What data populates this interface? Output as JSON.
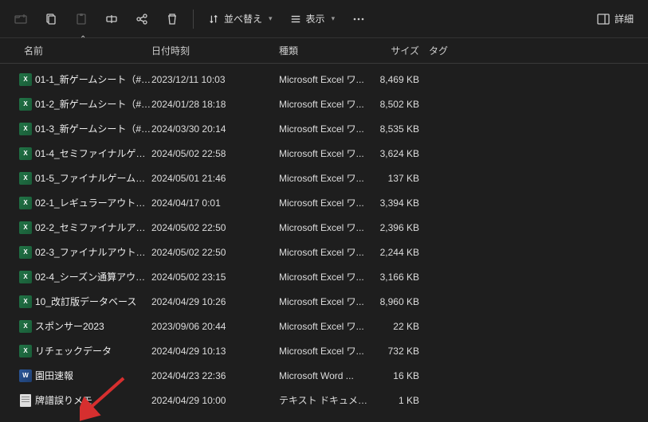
{
  "toolbar": {
    "sort_label": "並べ替え",
    "view_label": "表示",
    "details_label": "詳細"
  },
  "columns": {
    "name": "名前",
    "date": "日付時刻",
    "kind": "種類",
    "size": "サイズ",
    "tag": "タグ"
  },
  "files": [
    {
      "name": "01-1_新ゲームシート（#0...",
      "date": "2023/12/11 10:03",
      "kind": "Microsoft Excel ワ...",
      "size": "8,469 KB",
      "icon": "xlsx"
    },
    {
      "name": "01-2_新ゲームシート（#0...",
      "date": "2024/01/28 18:18",
      "kind": "Microsoft Excel ワ...",
      "size": "8,502 KB",
      "icon": "xlsx"
    },
    {
      "name": "01-3_新ゲームシート（#1...",
      "date": "2024/03/30 20:14",
      "kind": "Microsoft Excel ワ...",
      "size": "8,535 KB",
      "icon": "xlsx"
    },
    {
      "name": "01-4_セミファイナルゲーム...",
      "date": "2024/05/02 22:58",
      "kind": "Microsoft Excel ワ...",
      "size": "3,624 KB",
      "icon": "xlsx"
    },
    {
      "name": "01-5_ファイナルゲームシート",
      "date": "2024/05/01 21:46",
      "kind": "Microsoft Excel ワ...",
      "size": "137 KB",
      "icon": "xlsx"
    },
    {
      "name": "02-1_レギュラーアウトプッ...",
      "date": "2024/04/17 0:01",
      "kind": "Microsoft Excel ワ...",
      "size": "3,394 KB",
      "icon": "xlsx"
    },
    {
      "name": "02-2_セミファイナルアウト...",
      "date": "2024/05/02 22:50",
      "kind": "Microsoft Excel ワ...",
      "size": "2,396 KB",
      "icon": "xlsx"
    },
    {
      "name": "02-3_ファイナルアウトプッ...",
      "date": "2024/05/02 22:50",
      "kind": "Microsoft Excel ワ...",
      "size": "2,244 KB",
      "icon": "xlsx"
    },
    {
      "name": "02-4_シーズン通算アウト...",
      "date": "2024/05/02 23:15",
      "kind": "Microsoft Excel ワ...",
      "size": "3,166 KB",
      "icon": "xlsx"
    },
    {
      "name": "10_改訂版データベース",
      "date": "2024/04/29 10:26",
      "kind": "Microsoft Excel ワ...",
      "size": "8,960 KB",
      "icon": "xlsx"
    },
    {
      "name": "スポンサー2023",
      "date": "2023/09/06 20:44",
      "kind": "Microsoft Excel ワ...",
      "size": "22 KB",
      "icon": "xlsx"
    },
    {
      "name": "リチェックデータ",
      "date": "2024/04/29 10:13",
      "kind": "Microsoft Excel ワ...",
      "size": "732 KB",
      "icon": "xlsx"
    },
    {
      "name": "園田速報",
      "date": "2024/04/23 22:36",
      "kind": "Microsoft Word ...",
      "size": "16 KB",
      "icon": "docx"
    },
    {
      "name": "牌譜誤りメモ",
      "date": "2024/04/29 10:00",
      "kind": "テキスト ドキュメント",
      "size": "1 KB",
      "icon": "txt"
    }
  ],
  "annotation": {
    "color": "#d62f2f"
  }
}
